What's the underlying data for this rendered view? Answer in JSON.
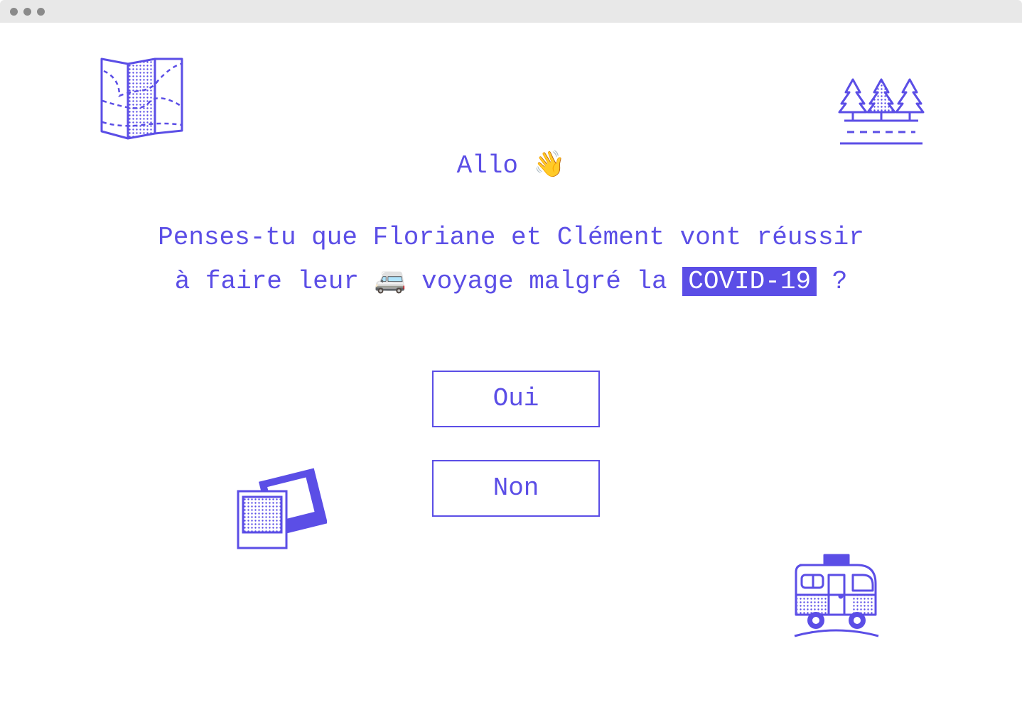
{
  "window": {
    "controls": [
      "dot",
      "dot",
      "dot"
    ]
  },
  "greeting": {
    "text": "Allo",
    "emoji": "👋"
  },
  "question": {
    "line1": "Penses-tu que Floriane et Clément vont réussir",
    "line2_before": "à faire leur",
    "line2_emoji": "🚐",
    "line2_middle": "voyage malgré la",
    "highlight": "COVID-19",
    "line2_after": "?"
  },
  "buttons": {
    "yes": "Oui",
    "no": "Non"
  },
  "icons": [
    "map-icon",
    "trees-icon",
    "photos-icon",
    "camper-van-icon"
  ],
  "colors": {
    "accent": "#5b4ee6",
    "background": "#ffffff",
    "titlebar": "#e8e8e8"
  }
}
